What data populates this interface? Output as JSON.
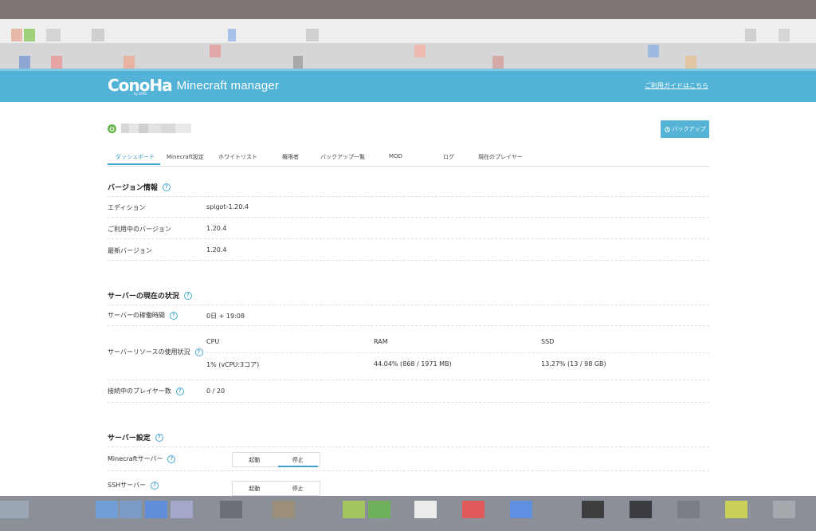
{
  "header": {
    "logo": "ConoHa",
    "logo_sub": "by GMO",
    "app_name": "Minecraft manager",
    "guide_link": "ご利用ガイドはこちら"
  },
  "server": {
    "backup_button": "バックアップ"
  },
  "tabs": [
    {
      "label": "ダッシュボード",
      "active": true
    },
    {
      "label": "Minecraft設定"
    },
    {
      "label": "ホワイトリスト"
    },
    {
      "label": "権限者"
    },
    {
      "label": "バックアップ一覧"
    },
    {
      "label": "MOD"
    },
    {
      "label": "ログ"
    },
    {
      "label": "現在のプレイヤー"
    }
  ],
  "version": {
    "title": "バージョン情報",
    "rows": [
      {
        "label": "エディション",
        "value": "spigot-1.20.4"
      },
      {
        "label": "ご利用中のバージョン",
        "value": "1.20.4"
      },
      {
        "label": "最新バージョン",
        "value": "1.20.4"
      }
    ]
  },
  "status": {
    "title": "サーバーの現在の状況",
    "uptime_label": "サーバーの稼働時間",
    "uptime_value": "0日 + 19:08",
    "resource_label": "サーバーリソースの使用状況",
    "cpu_header": "CPU",
    "ram_header": "RAM",
    "ssd_header": "SSD",
    "cpu_value": "1% (vCPU:3コア)",
    "ram_value": "44.04% (868 / 1971 MB)",
    "ssd_value": "13.27% (13 / 98 GB)",
    "players_label": "接続中のプレイヤー数",
    "players_value": "0 / 20"
  },
  "settings": {
    "title": "サーバー設定",
    "minecraft_label": "Minecraftサーバー",
    "ssh_label": "SSHサーバー",
    "start": "起動",
    "stop": "停止"
  },
  "colors": {
    "header_bg": "#52b3d6",
    "accent": "#3ba3cc",
    "power_green": "#64b447"
  }
}
